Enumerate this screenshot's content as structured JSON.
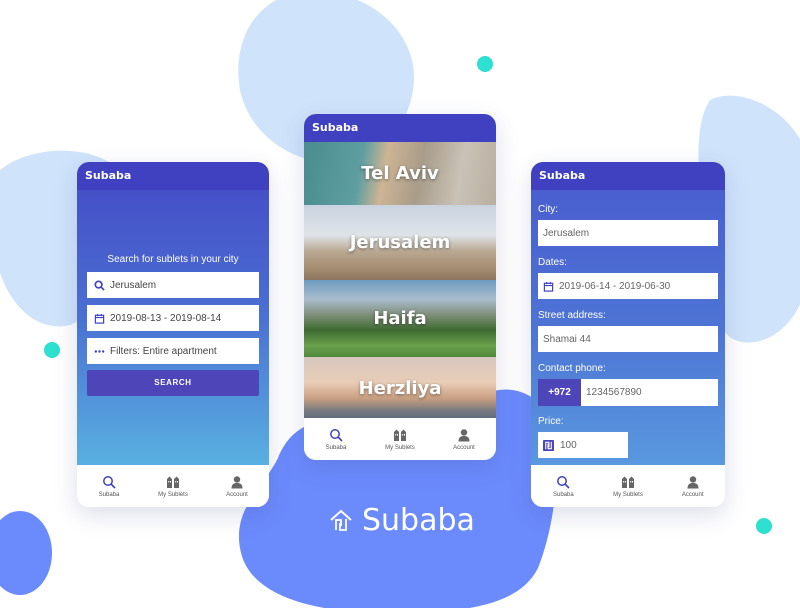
{
  "colors": {
    "primary": "#3f41c0",
    "button": "#4d45b8",
    "accent_dot": "#2de0cf",
    "blob_light": "#cfe3fb",
    "blob_dark": "#6b8afc"
  },
  "brand": {
    "name": "Subaba",
    "logo_icon": "house-shekel-icon"
  },
  "search_screen": {
    "app_title": "Subaba",
    "heading": "Search for sublets in your city",
    "city_field": {
      "icon": "search-icon",
      "value": "Jerusalem"
    },
    "dates_field": {
      "icon": "calendar-icon",
      "value": "2019-08-13 - 2019-08-14"
    },
    "filters_field": {
      "icon": "more-dots-icon",
      "value": "Filters: Entire apartment"
    },
    "search_button": "SEARCH"
  },
  "cities_screen": {
    "app_title": "Subaba",
    "cities": [
      {
        "name": "Tel Aviv"
      },
      {
        "name": "Jerusalem"
      },
      {
        "name": "Haifa"
      },
      {
        "name": "Herzliya"
      }
    ]
  },
  "form_screen": {
    "app_title": "Subaba",
    "city": {
      "label": "City:",
      "value": "Jerusalem"
    },
    "dates": {
      "label": "Dates:",
      "value": "2019-06-14 - 2019-06-30"
    },
    "street": {
      "label": "Street address:",
      "value": "Shamai 44"
    },
    "phone": {
      "label": "Contact phone:",
      "prefix": "+972",
      "value": "1234567890"
    },
    "price": {
      "label": "Price:",
      "currency_icon": "shekel-icon",
      "value": "100"
    }
  },
  "tabbar": {
    "items": [
      {
        "label": "Subaba",
        "icon": "search-icon"
      },
      {
        "label": "My Sublets",
        "icon": "buildings-icon"
      },
      {
        "label": "Account",
        "icon": "user-icon"
      }
    ]
  }
}
